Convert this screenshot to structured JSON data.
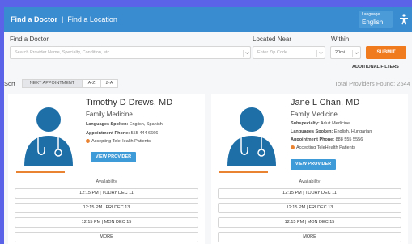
{
  "header": {
    "find_doctor": "Find a Doctor",
    "separator": "|",
    "find_location": "Find a Location",
    "language_label": "Language",
    "language_value": "English"
  },
  "search": {
    "find_label": "Find a Doctor",
    "find_placeholder": "Search Provider Name, Specialty, Condition, etc",
    "near_label": "Located Near",
    "near_placeholder": "Enter Zip Code",
    "within_label": "Within",
    "within_value": "20mi",
    "submit_label": "SUBMIT",
    "advanced_label": "ADDITIONAL FILTERS"
  },
  "sort": {
    "label": "Sort",
    "options": [
      "NEXT APPOINTMENT",
      "A-Z",
      "Z-A"
    ],
    "total": "Total Providers Found: 2544"
  },
  "providers": [
    {
      "name": "Timothy D Drews, MD",
      "specialty": "Family Medicine",
      "languages_label": "Languages Spoken:",
      "languages": "English, Spanish",
      "phone_label": "Appointment Phone:",
      "phone": "555 444 6666",
      "telehealth": "Accepting TeleHealth Patients",
      "view_label": "VIEW PROVIDER",
      "availability_label": "Availability",
      "slots": [
        "12:15 PM | TODAY DEC 11",
        "12:15 PM | FRI DEC 13",
        "12:15 PM | MON DEC 15",
        "MORE"
      ]
    },
    {
      "name": "Jane L Chan, MD",
      "specialty": "Family Medicine",
      "subspecialty_label": "Subspecialty:",
      "subspecialty": "Adult Medicine",
      "languages_label": "Languages Spoken:",
      "languages": "English, Hungarian",
      "phone_label": "Appointment Phone:",
      "phone": "888 555 5556",
      "telehealth": "Accepting TeleHealth Patients",
      "view_label": "VIEW PROVIDER",
      "availability_label": "Availability",
      "slots": [
        "12:15 PM | TODAY DEC 11",
        "12:15 PM | FRI DEC 13",
        "12:15 PM | MON DEC 15",
        "MORE"
      ]
    }
  ],
  "colors": {
    "header": "#3a8cd0",
    "accent": "#f07a1e",
    "button": "#3f9ad8",
    "background": "#5b63e8"
  }
}
